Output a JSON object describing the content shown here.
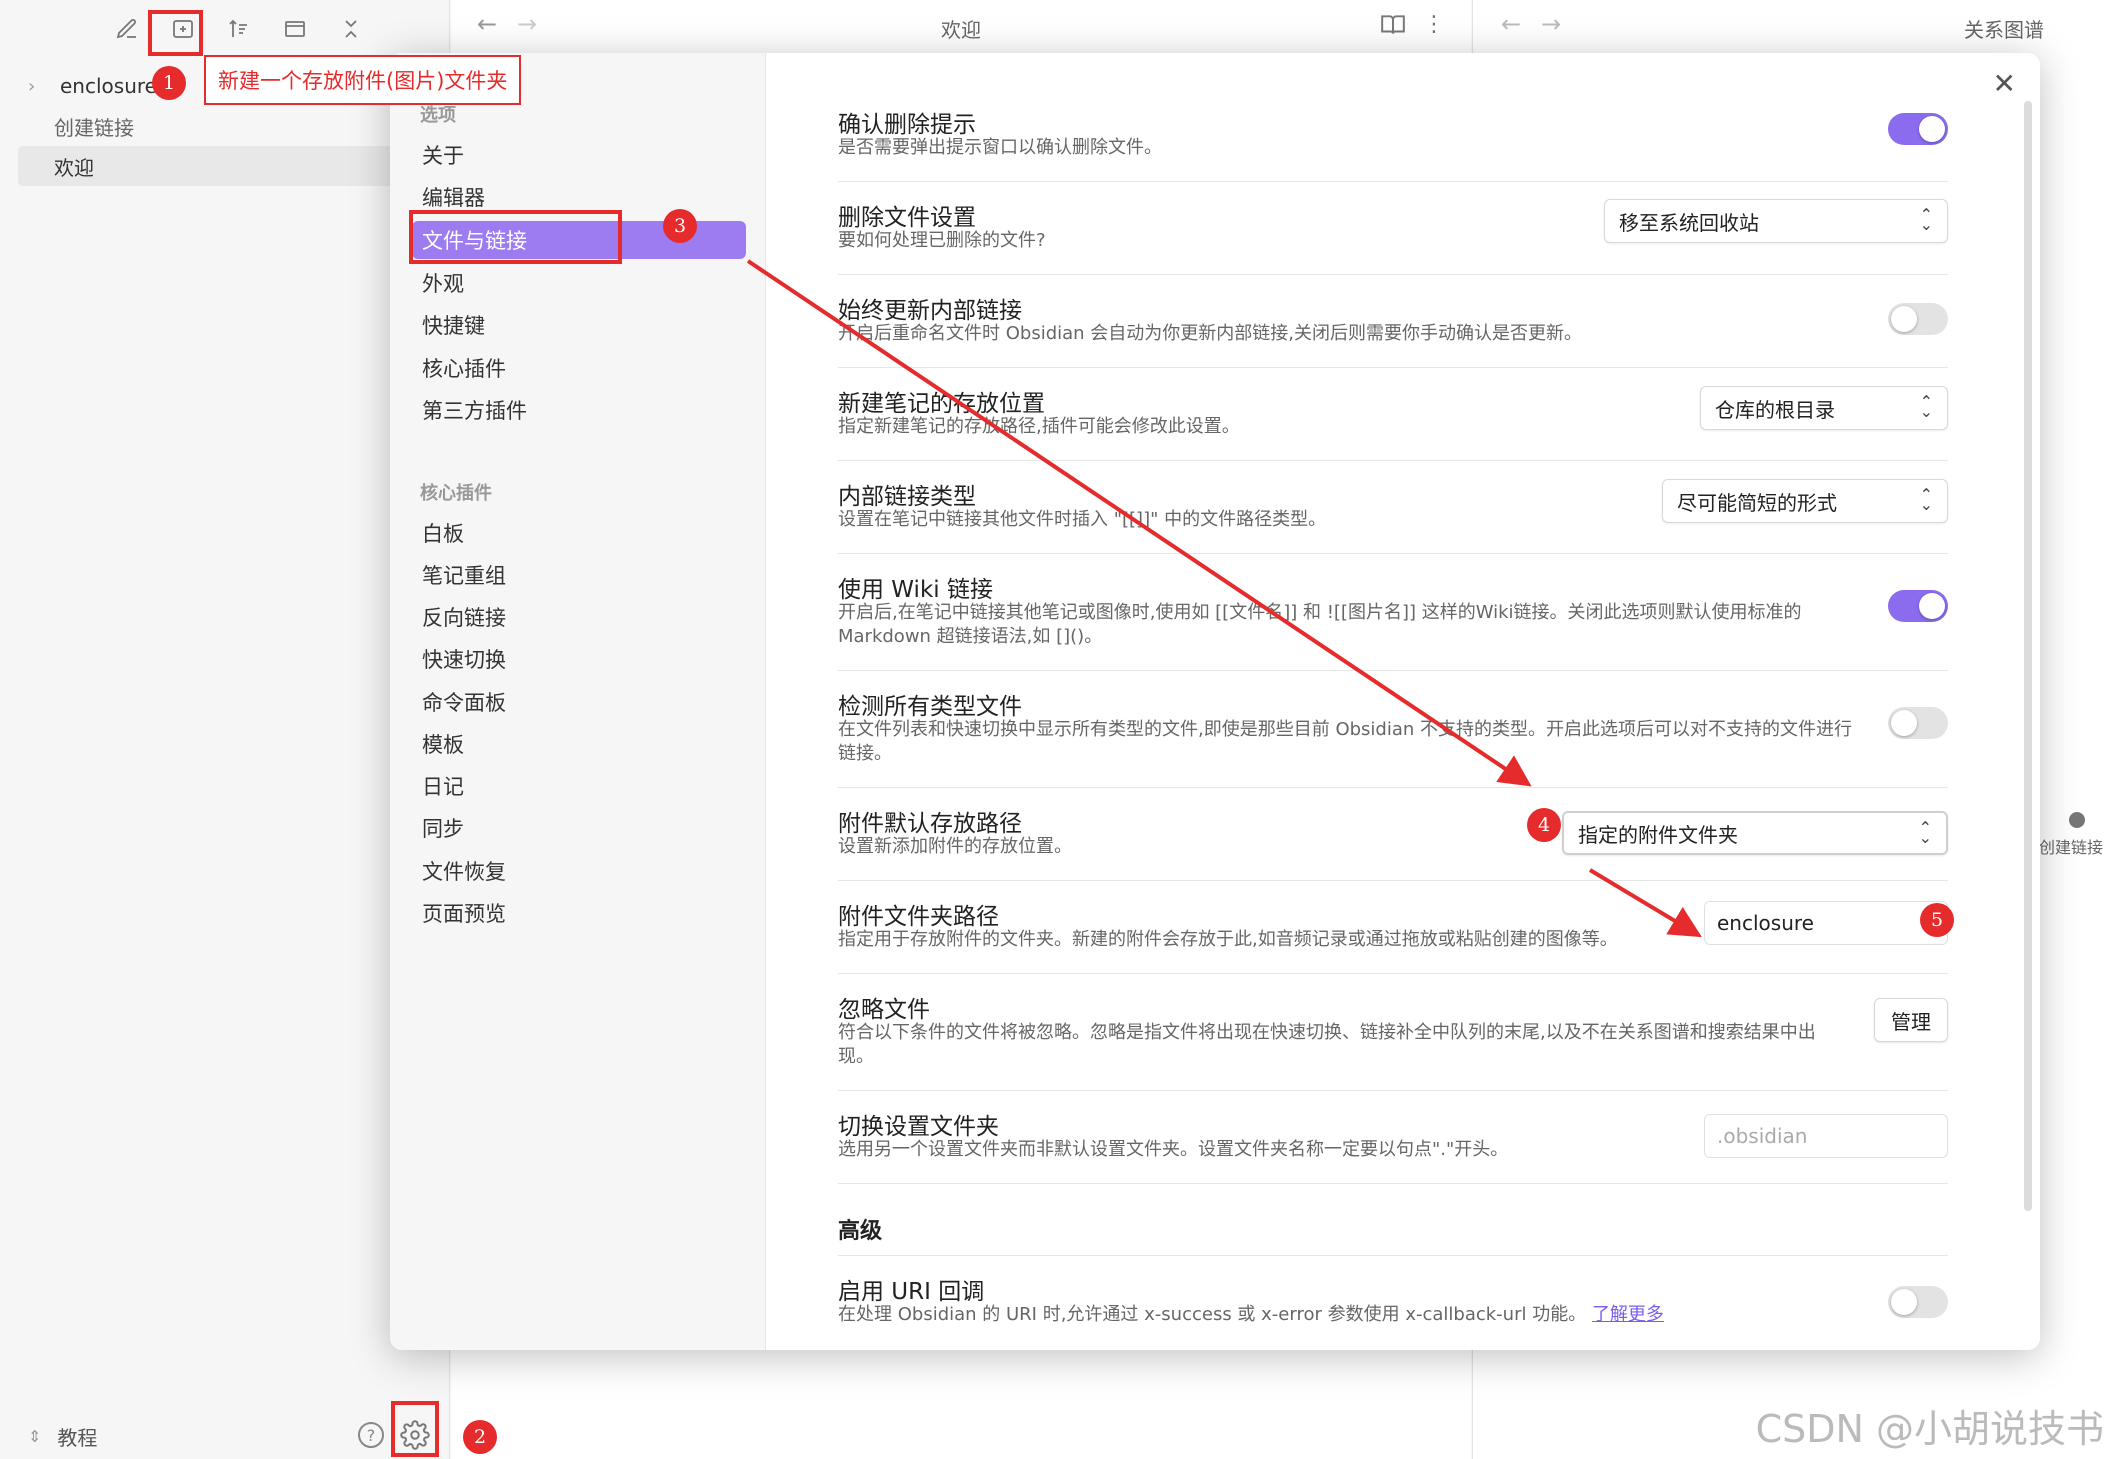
{
  "left_pane": {
    "file_tree": [
      {
        "label": "enclosure",
        "type": "folder"
      },
      {
        "label": "创建链接",
        "type": "file"
      },
      {
        "label": "欢迎",
        "type": "file",
        "active": true
      }
    ],
    "vault_name": "教程"
  },
  "center_pane": {
    "title": "欢迎"
  },
  "right_pane": {
    "title": "关系图谱",
    "node_label": "创建链接"
  },
  "settings": {
    "sidebar": {
      "section_options": "选项",
      "options": [
        "关于",
        "编辑器",
        "文件与链接",
        "外观",
        "快捷键",
        "核心插件",
        "第三方插件"
      ],
      "section_core": "核心插件",
      "core_plugins": [
        "白板",
        "笔记重组",
        "反向链接",
        "快速切换",
        "命令面板",
        "模板",
        "日记",
        "同步",
        "文件恢复",
        "页面预览"
      ]
    },
    "items": [
      {
        "name": "确认删除提示",
        "desc": "是否需要弹出提示窗口以确认删除文件。",
        "control": "toggle",
        "on": true
      },
      {
        "name": "删除文件设置",
        "desc": "要如何处理已删除的文件?",
        "control": "dropdown",
        "value": "移至系统回收站"
      },
      {
        "name": "始终更新内部链接",
        "desc": "开启后重命名文件时 Obsidian 会自动为你更新内部链接,关闭后则需要你手动确认是否更新。",
        "control": "toggle",
        "on": false
      },
      {
        "name": "新建笔记的存放位置",
        "desc": "指定新建笔记的存放路径,插件可能会修改此设置。",
        "control": "dropdown",
        "value": "仓库的根目录"
      },
      {
        "name": "内部链接类型",
        "desc": "设置在笔记中链接其他文件时插入 \"[[]]\" 中的文件路径类型。",
        "control": "dropdown",
        "value": "尽可能简短的形式"
      },
      {
        "name": "使用 Wiki 链接",
        "desc": "开启后,在笔记中链接其他笔记或图像时,使用如 [[文件名]] 和 ![[图片名]] 这样的Wiki链接。关闭此选项则默认使用标准的 Markdown 超链接语法,如 []()。",
        "control": "toggle",
        "on": true
      },
      {
        "name": "检测所有类型文件",
        "desc": "在文件列表和快速切换中显示所有类型的文件,即使是那些目前 Obsidian 不支持的类型。开启此选项后可以对不支持的文件进行链接。",
        "control": "toggle",
        "on": false
      },
      {
        "name": "附件默认存放路径",
        "desc": "设置新添加附件的存放位置。",
        "control": "dropdown",
        "value": "指定的附件文件夹"
      },
      {
        "name": "附件文件夹路径",
        "desc": "指定用于存放附件的文件夹。新建的附件会存放于此,如音频记录或通过拖放或粘贴创建的图像等。",
        "control": "text",
        "value": "enclosure"
      },
      {
        "name": "忽略文件",
        "desc": "符合以下条件的文件将被忽略。忽略是指文件将出现在快速切换、链接补全中队列的末尾,以及不在关系图谱和搜索结果中出现。",
        "control": "button",
        "value": "管理"
      },
      {
        "name": "切换设置文件夹",
        "desc": "选用另一个设置文件夹而非默认设置文件夹。设置文件夹名称一定要以句点\".\"开头。",
        "control": "text",
        "placeholder": ".obsidian"
      }
    ],
    "advanced_title": "高级",
    "uri": {
      "name": "启用 URI 回调",
      "desc": "在处理 Obsidian 的 URI 时,允许通过 x-success 或 x-error 参数使用 x-callback-url 功能。",
      "link": "了解更多",
      "on": false
    }
  },
  "annotations": {
    "callout": "新建一个存放附件(图片)文件夹",
    "markers": [
      "1",
      "2",
      "3",
      "4",
      "5"
    ]
  },
  "watermark": "CSDN @小胡说技书",
  "colors": {
    "accent": "#8b6cef",
    "annotation_red": "#e52b2b"
  }
}
